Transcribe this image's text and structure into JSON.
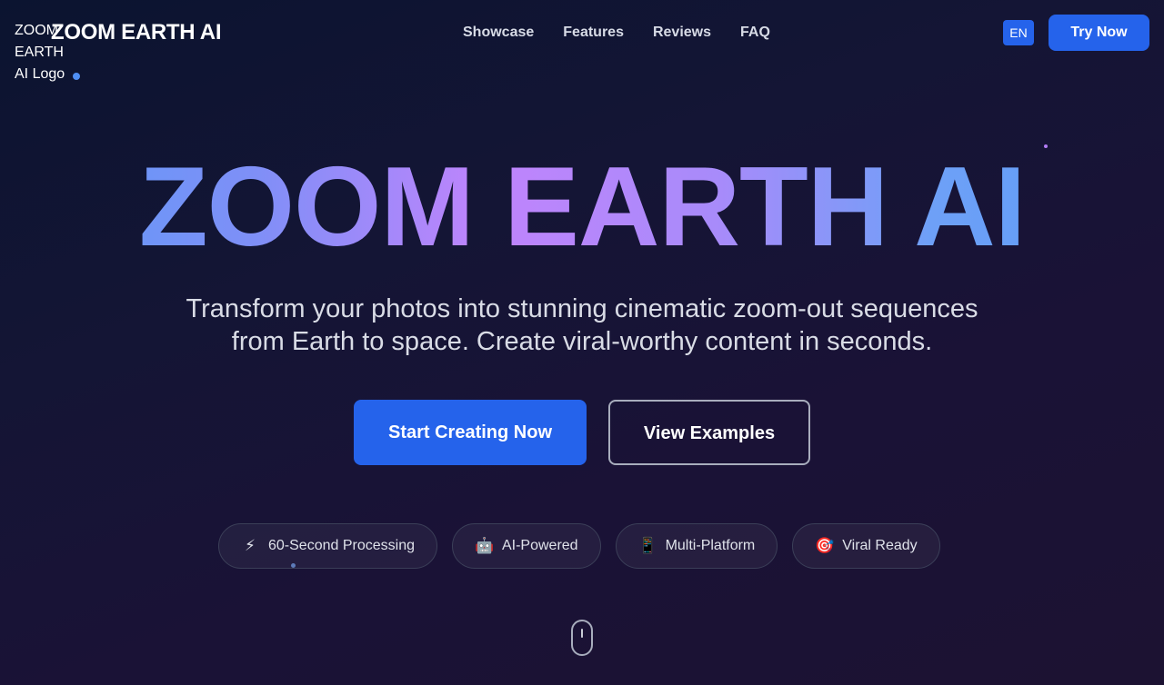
{
  "header": {
    "logo_alt": "ZOOM EARTH AI Logo",
    "logo_text": "ZOOM EARTH AI",
    "nav": [
      "Showcase",
      "Features",
      "Reviews",
      "FAQ"
    ],
    "language": "EN",
    "try_button": "Try Now"
  },
  "hero": {
    "title": "ZOOM EARTH AI",
    "subtitle_line1": "Transform your photos into stunning cinematic zoom-out sequences",
    "subtitle_line2": "from Earth to space. Create viral-worthy content in seconds.",
    "primary_cta": "Start Creating Now",
    "secondary_cta": "View Examples"
  },
  "features": [
    {
      "icon": "⚡",
      "icon_name": "lightning-icon",
      "label": "60-Second Processing"
    },
    {
      "icon": "🤖",
      "icon_name": "robot-icon",
      "label": "AI-Powered"
    },
    {
      "icon": "📱",
      "icon_name": "mobile-phone-icon",
      "label": "Multi-Platform"
    },
    {
      "icon": "🎯",
      "icon_name": "target-icon",
      "label": "Viral Ready"
    }
  ],
  "colors": {
    "accent_blue": "#2563eb",
    "gradient_blue": "#5b9cf7",
    "gradient_purple": "#c084fc",
    "background_dark": "#141535"
  }
}
